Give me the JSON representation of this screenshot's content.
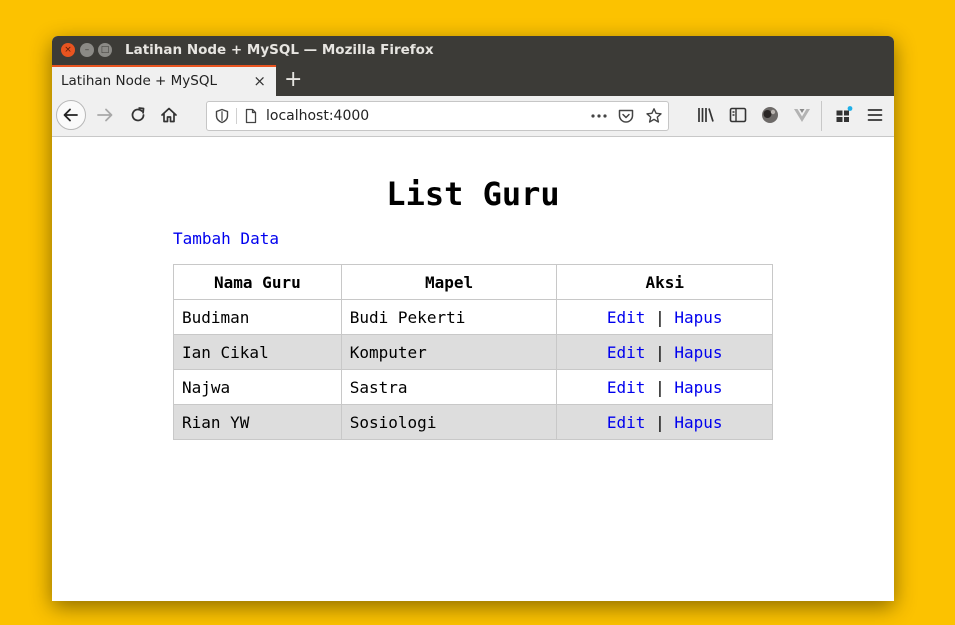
{
  "window": {
    "title": "Latihan Node + MySQL — Mozilla Firefox",
    "controls": {
      "close": "×",
      "minimize": "–",
      "maximize": "□"
    }
  },
  "tab": {
    "title": "Latihan Node + MySQL",
    "close": "×",
    "new_tab": "+"
  },
  "url": "localhost:4000",
  "icons": [
    "back-icon",
    "forward-icon",
    "reload-icon",
    "home-icon",
    "shield-icon",
    "page-icon",
    "more-icon",
    "pocket-icon",
    "star-icon",
    "library-icon",
    "sidebar-icon",
    "avatar-icon",
    "extension-icon",
    "addons-icon",
    "menu-icon"
  ],
  "colors": {
    "accent": "#e95420",
    "link": "#0000ee",
    "desktop": "#fcc200",
    "row_alt": "#dddddd"
  },
  "page": {
    "title": "List Guru",
    "add_link": "Tambah Data",
    "table": {
      "headers": [
        "Nama Guru",
        "Mapel",
        "Aksi"
      ],
      "rows": [
        {
          "nama": "Budiman",
          "mapel": "Budi Pekerti",
          "edit": "Edit",
          "sep": "|",
          "hapus": "Hapus"
        },
        {
          "nama": "Ian Cikal",
          "mapel": "Komputer",
          "edit": "Edit",
          "sep": "|",
          "hapus": "Hapus"
        },
        {
          "nama": "Najwa",
          "mapel": "Sastra",
          "edit": "Edit",
          "sep": "|",
          "hapus": "Hapus"
        },
        {
          "nama": "Rian YW",
          "mapel": "Sosiologi",
          "edit": "Edit",
          "sep": "|",
          "hapus": "Hapus"
        }
      ]
    }
  }
}
